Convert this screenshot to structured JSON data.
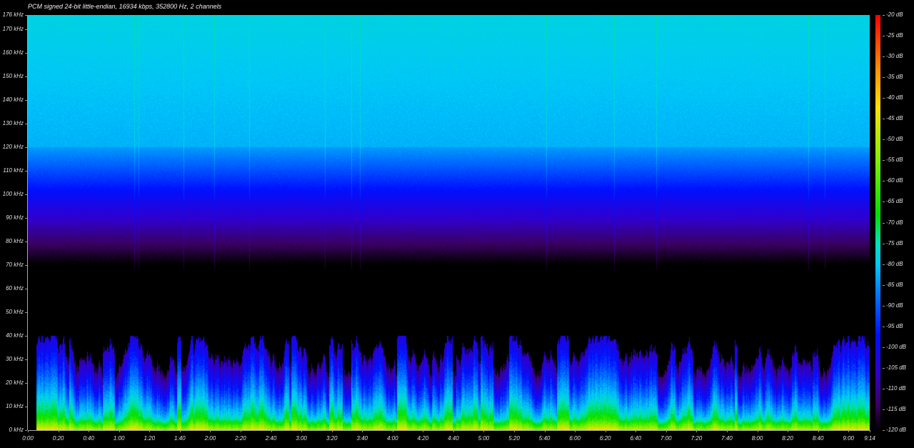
{
  "chart_data": {
    "type": "heatmap",
    "subtype": "spectrogram",
    "title": "PCM signed 24-bit little-endian, 16934 kbps, 352800 Hz, 2 channels",
    "xlabel": "",
    "ylabel": "",
    "x_range_seconds": [
      0,
      554
    ],
    "y_range_khz": [
      0,
      176
    ],
    "x_ticks": [
      "0:00",
      "0:20",
      "0:40",
      "1:00",
      "1:20",
      "1:40",
      "2:00",
      "2:20",
      "2:40",
      "3:00",
      "3:20",
      "3:40",
      "4:00",
      "4:20",
      "4:40",
      "5:00",
      "5:20",
      "5:40",
      "6:00",
      "6:20",
      "6:40",
      "7:00",
      "7:20",
      "7:40",
      "8:00",
      "8:20",
      "8:40",
      "9:00",
      "9:14"
    ],
    "y_ticks": [
      "0 kHz",
      "10 kHz",
      "20 kHz",
      "30 kHz",
      "40 kHz",
      "50 kHz",
      "60 kHz",
      "70 kHz",
      "80 kHz",
      "90 kHz",
      "100 kHz",
      "110 kHz",
      "120 kHz",
      "130 kHz",
      "140 kHz",
      "150 kHz",
      "160 kHz",
      "170 kHz",
      "176 kHz"
    ],
    "colorbar_ticks": [
      "-20 dB",
      "-25 dB",
      "-30 dB",
      "-35 dB",
      "-40 dB",
      "-45 dB",
      "-50 dB",
      "-55 dB",
      "-60 dB",
      "-65 dB",
      "-70 dB",
      "-75 dB",
      "-80 dB",
      "-85 dB",
      "-90 dB",
      "-95 dB",
      "-100 dB",
      "-105 dB",
      "-110 dB",
      "-115 dB",
      "-120 dB"
    ],
    "colorbar_range_db": [
      -120,
      -20
    ],
    "colormap": [
      {
        "db": -120,
        "color": "#000000"
      },
      {
        "db": -114,
        "color": "#3a0060"
      },
      {
        "db": -106,
        "color": "#3000d0"
      },
      {
        "db": -97,
        "color": "#0010ff"
      },
      {
        "db": -88,
        "color": "#0070ff"
      },
      {
        "db": -80,
        "color": "#00c8f8"
      },
      {
        "db": -75,
        "color": "#00e0c0"
      },
      {
        "db": -68,
        "color": "#00e000"
      },
      {
        "db": -55,
        "color": "#80f000"
      },
      {
        "db": -42,
        "color": "#ffe000"
      },
      {
        "db": -33,
        "color": "#ff9000"
      },
      {
        "db": -20,
        "color": "#ff0000"
      }
    ],
    "profile_summary": {
      "high_band_khz": [
        120,
        176
      ],
      "high_band_db": -82,
      "blue_band_khz": [
        90,
        110
      ],
      "blue_band_db": -97,
      "noise_floor_cutoff_khz": 68,
      "content_max_khz": 40,
      "strong_content_max_khz": 5
    }
  }
}
